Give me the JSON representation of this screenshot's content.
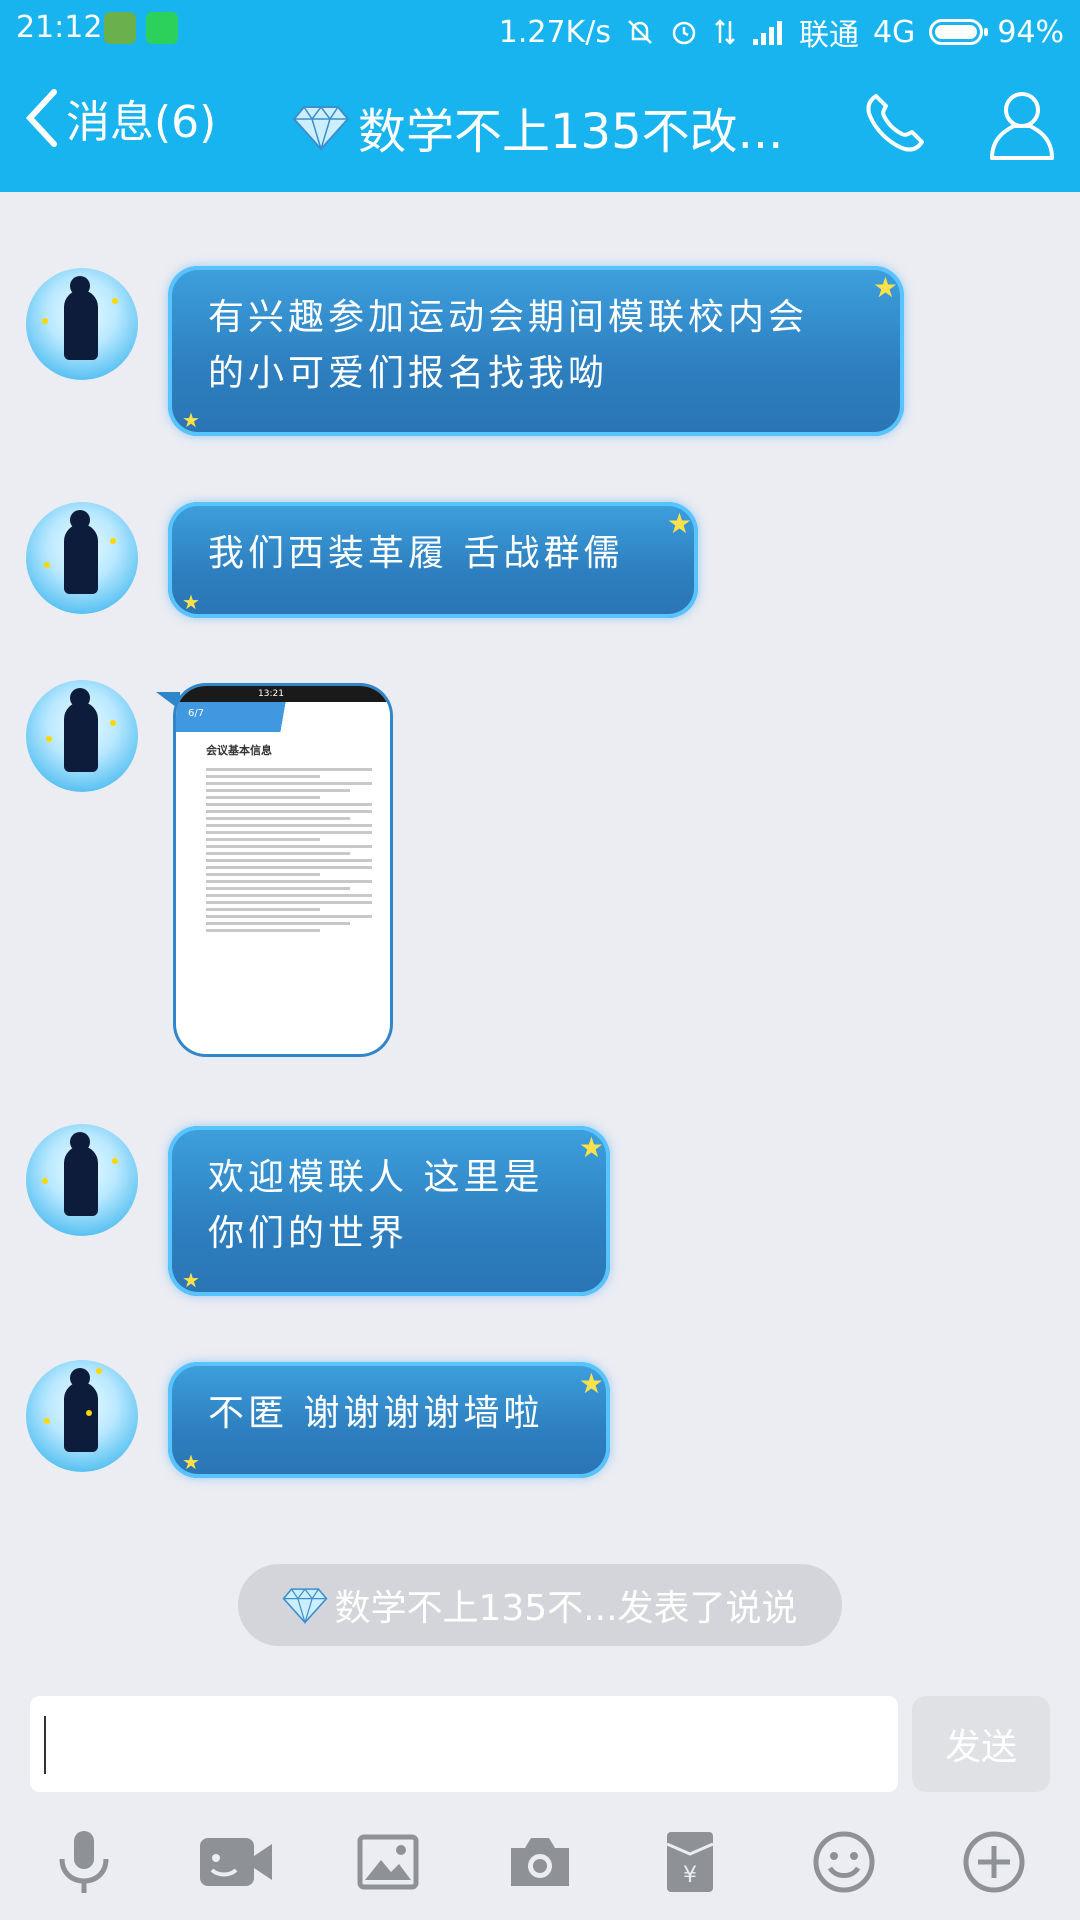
{
  "status_bar": {
    "time": "21:12",
    "network_speed": "1.27K/s",
    "carrier": "联通",
    "network_type": "4G",
    "battery": "94%"
  },
  "header": {
    "back_label": "消息(6)",
    "title": "数学不上135不改..."
  },
  "messages": [
    {
      "type": "text",
      "text_line1": "有兴趣参加运动会期间模联校内会",
      "text_line2": "的小可爱们报名找我呦"
    },
    {
      "type": "text",
      "text_line1": "我们西装革履 舌战群儒"
    },
    {
      "type": "image",
      "thumb_status_time": "13:21",
      "thumb_page": "6/7",
      "thumb_title": "会议基本信息"
    },
    {
      "type": "text",
      "text_line1": "欢迎模联人 这里是",
      "text_line2": "你们的世界"
    },
    {
      "type": "text",
      "text_line1": "不匿 谢谢谢谢墙啦"
    }
  ],
  "notice": {
    "text": "数学不上135不...发表了说说"
  },
  "composer": {
    "input_value": "",
    "send_label": "发送"
  },
  "toolbar": {
    "icons": [
      "microphone-icon",
      "video-icon",
      "image-icon",
      "camera-icon",
      "red-packet-icon",
      "emoji-icon",
      "plus-icon"
    ]
  },
  "colors": {
    "accent": "#18b4ef",
    "bubble": "#2d7fbf",
    "background": "#ecedf3"
  }
}
